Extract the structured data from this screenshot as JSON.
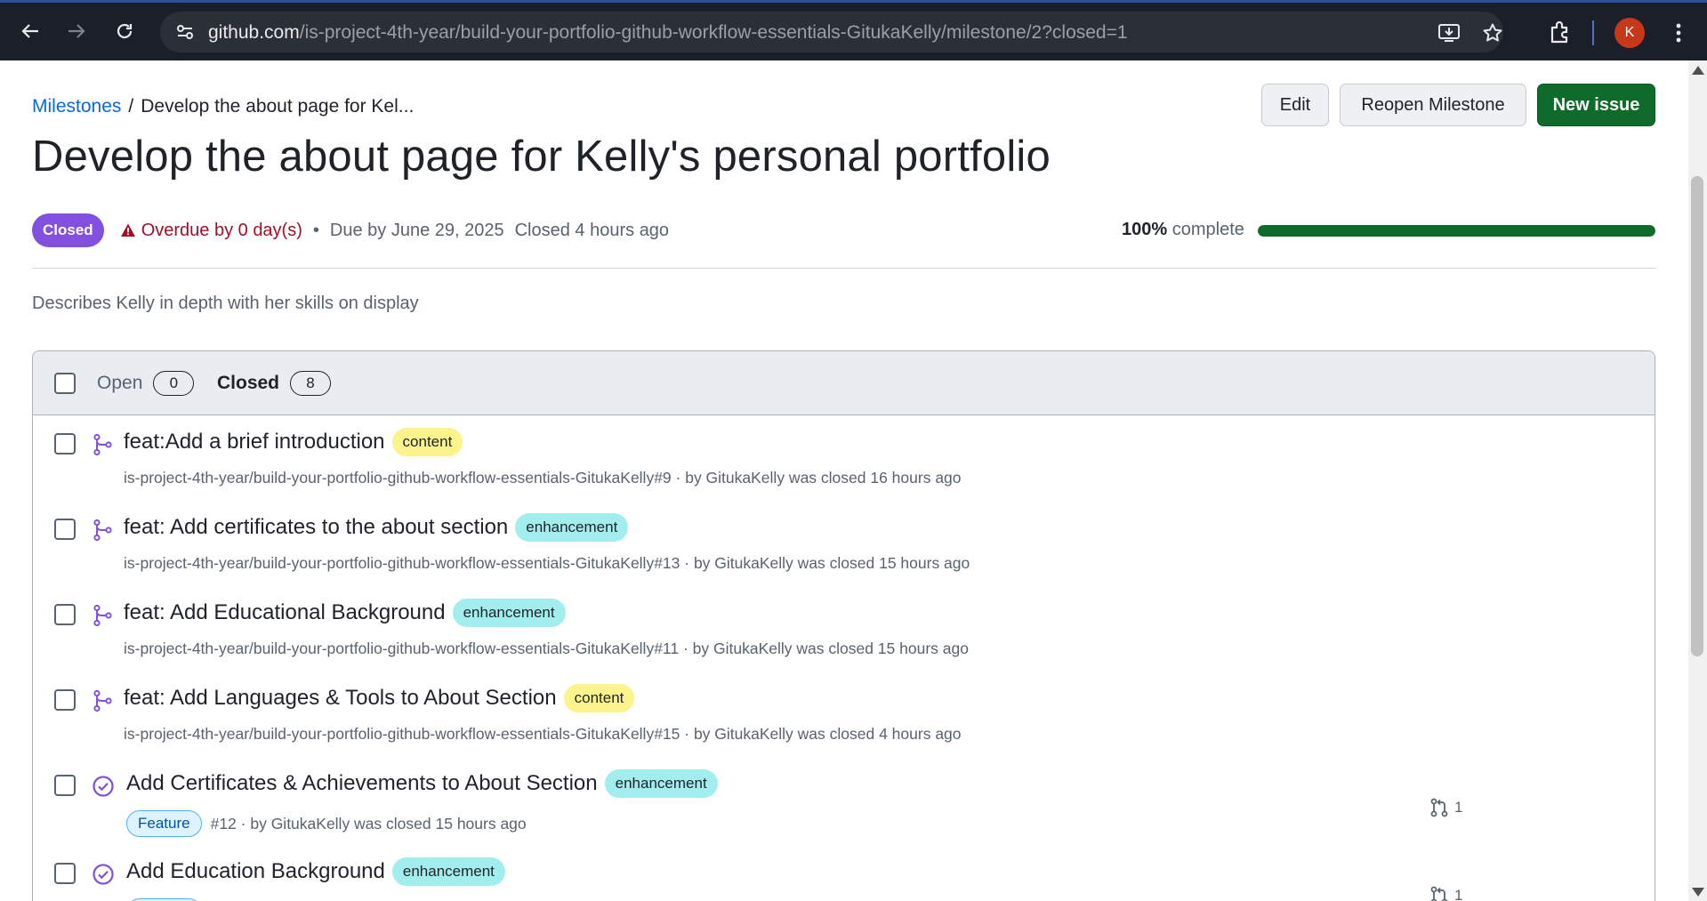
{
  "browser": {
    "url_host": "github.com",
    "url_path": "/is-project-4th-year/build-your-portfolio-github-workflow-essentials-GitukaKelly/milestone/2?closed=1",
    "avatar_letter": "K"
  },
  "breadcrumb": {
    "root": "Milestones",
    "separator": "/",
    "current": "Develop the about page for Kel..."
  },
  "actions": {
    "edit": "Edit",
    "reopen": "Reopen Milestone",
    "new_issue": "New issue"
  },
  "milestone": {
    "title": "Develop the about page for Kelly's personal portfolio",
    "state": "Closed",
    "overdue": "Overdue by 0 day(s)",
    "bullet": "•",
    "due": "Due by June 29, 2025",
    "closed": "Closed 4 hours ago",
    "progress_percent_text": "100%",
    "progress_suffix": "complete",
    "progress_fraction": 1.0,
    "description": "Describes Kelly in depth with her skills on display"
  },
  "tabs": {
    "open_label": "Open",
    "open_count": "0",
    "closed_label": "Closed",
    "closed_count": "8"
  },
  "issues": [
    {
      "title": "feat:Add a brief introduction",
      "label": "content",
      "meta": "is-project-4th-year/build-your-portfolio-github-workflow-essentials-GitukaKelly#9 · by GitukaKelly was closed 16 hours ago"
    },
    {
      "title": "feat: Add certificates to the about section",
      "label": "enhancement",
      "meta": "is-project-4th-year/build-your-portfolio-github-workflow-essentials-GitukaKelly#13 · by GitukaKelly was closed 15 hours ago"
    },
    {
      "title": "feat: Add Educational Background",
      "label": "enhancement",
      "meta": "is-project-4th-year/build-your-portfolio-github-workflow-essentials-GitukaKelly#11 · by GitukaKelly was closed 15 hours ago"
    },
    {
      "title": "feat: Add Languages & Tools to About Section",
      "label": "content",
      "meta": "is-project-4th-year/build-your-portfolio-github-workflow-essentials-GitukaKelly#15 · by GitukaKelly was closed 4 hours ago"
    },
    {
      "title": "Add Certificates & Achievements to About Section",
      "label": "enhancement",
      "type": "Feature",
      "meta": "#12 · by GitukaKelly was closed 15 hours ago",
      "pr_count": "1"
    },
    {
      "title": "Add Education Background",
      "label": "enhancement",
      "type": "Feature",
      "meta": "",
      "pr_count": "1"
    }
  ],
  "colors": {
    "closed_badge": "#8250df",
    "primary_button": "#0f6b2a",
    "label_content": "#fbf48c",
    "label_enhancement": "#a2eeef",
    "link": "#0969da",
    "overdue": "#a40e26"
  }
}
